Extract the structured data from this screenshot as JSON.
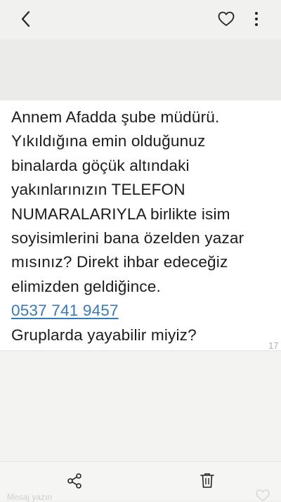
{
  "icons": {
    "back": "chevron-left-icon",
    "favorite": "heart-icon",
    "more": "vertical-ellipsis-icon",
    "share": "share-icon",
    "delete": "trash-icon"
  },
  "message": {
    "lines": [
      "Annem Afadda şube müdürü.",
      "Yıkıldığına emin olduğunuz",
      "binalarda göçük altındaki",
      "yakınlarınızın TELEFON",
      "NUMARALARIYLA birlikte isim",
      "soyisimlerini bana özelden yazar",
      "mısınız? Direkt ihbar edeceğiz",
      "elimizden geldiğince."
    ],
    "phone": "0537 741 9457",
    "last_line": "Gruplarda yayabilir miyiz?",
    "time_partial": "17"
  },
  "bottom": {
    "peek_text": "Mesaj yazın"
  },
  "colors": {
    "link": "#3a79b8",
    "background": "#f1f1ef"
  }
}
